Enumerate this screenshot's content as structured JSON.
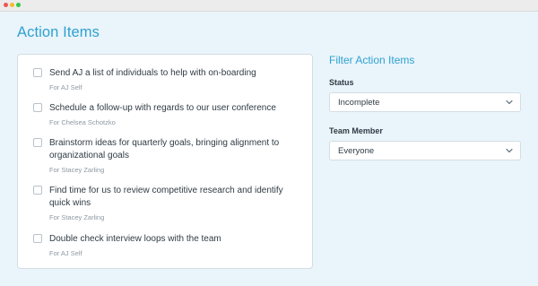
{
  "window": {
    "controls": [
      "close",
      "minimize",
      "maximize"
    ]
  },
  "header": {
    "title": "Action Items"
  },
  "items": [
    {
      "text": "Send AJ a list of individuals to help with on-boarding",
      "owner": "For AJ Self",
      "checked": false
    },
    {
      "text": "Schedule a follow-up with regards to our user conference",
      "owner": "For Chelsea Schotzko",
      "checked": false
    },
    {
      "text": "Brainstorm ideas for quarterly goals, bringing alignment to organizational goals",
      "owner": "For Stacey Zarling",
      "checked": false
    },
    {
      "text": "Find time for us to review competitive research and identify quick wins",
      "owner": "For Stacey Zarling",
      "checked": false
    },
    {
      "text": "Double check interview loops with the team",
      "owner": "For AJ Self",
      "checked": false
    }
  ],
  "filters": {
    "title": "Filter Action Items",
    "status": {
      "label": "Status",
      "value": "Incomplete"
    },
    "team_member": {
      "label": "Team Member",
      "value": "Everyone"
    }
  },
  "colors": {
    "accent": "#2ea2cf",
    "background": "#eaf4fb",
    "text": "#2f3b44",
    "muted": "#8d99a3"
  },
  "icons": {
    "select_chevron": "chevron-down-icon"
  }
}
